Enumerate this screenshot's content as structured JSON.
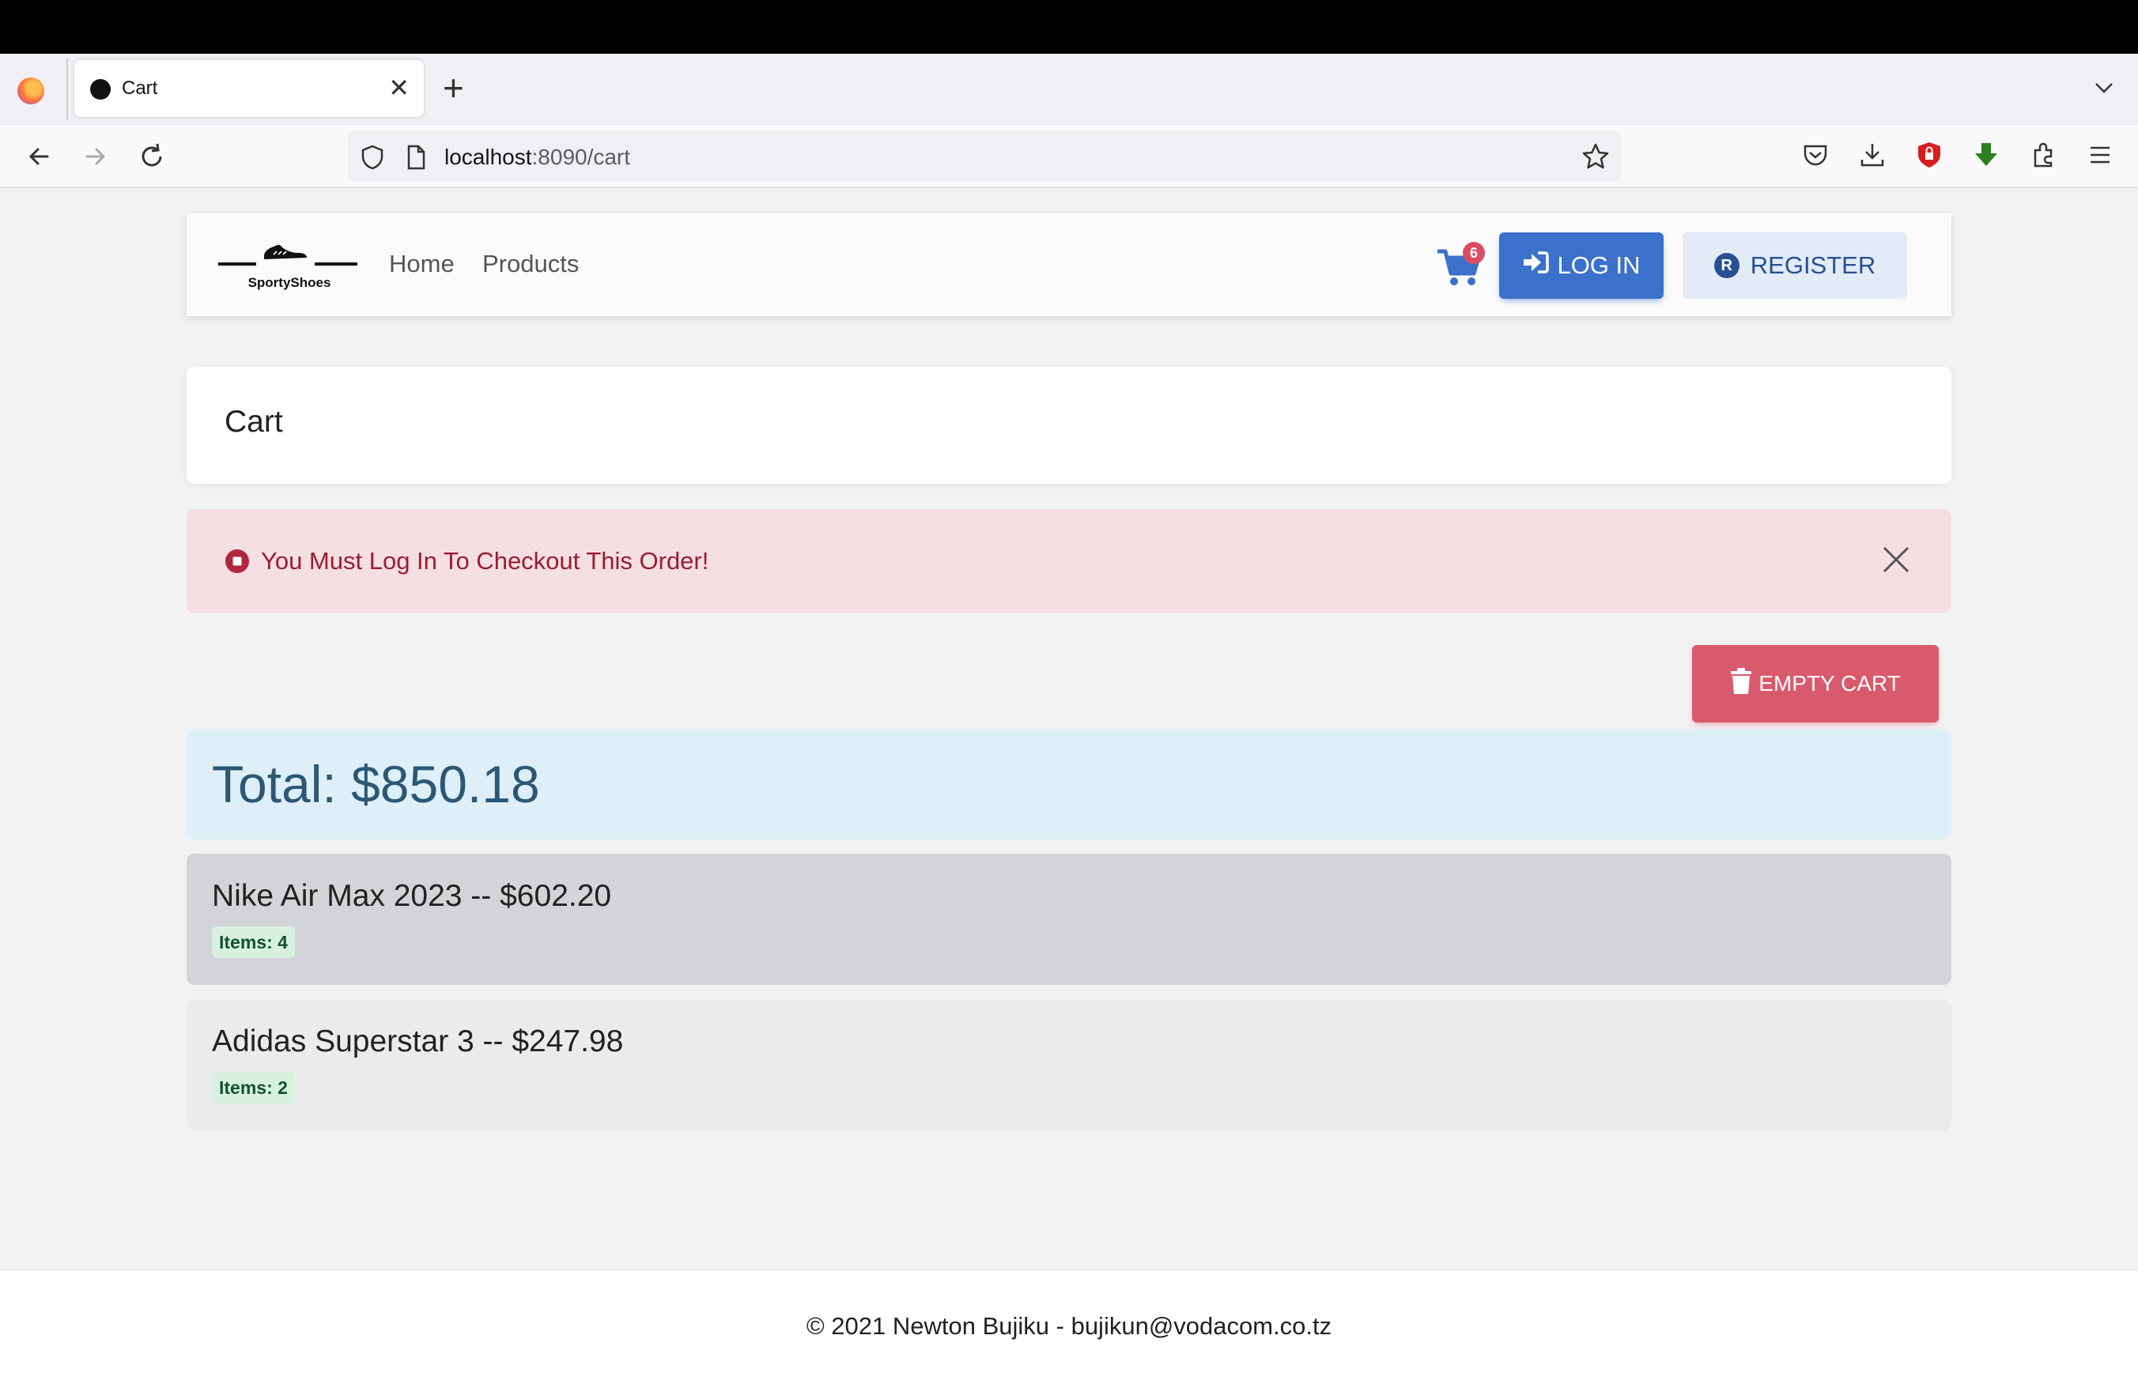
{
  "browser": {
    "tab_title": "Cart",
    "url_host": "localhost",
    "url_rest": ":8090/cart"
  },
  "site": {
    "brand": "SportyShoes",
    "nav": {
      "home": "Home",
      "products": "Products"
    },
    "cart_count": "6",
    "login_label": "LOG IN",
    "register_label": "REGISTER",
    "register_badge": "R"
  },
  "page": {
    "title": "Cart",
    "alert_message": "You Must Log In To Checkout This Order!",
    "empty_cart_label": "EMPTY CART",
    "total": "Total: $850.18",
    "items": [
      {
        "title": "Nike Air Max 2023 -- $602.20",
        "badge": "Items: 4"
      },
      {
        "title": "Adidas Superstar 3 -- $247.98",
        "badge": "Items: 2"
      }
    ]
  },
  "footer": {
    "text": "© 2021 Newton Bujiku - bujikun@vodacom.co.tz"
  },
  "colors": {
    "primary": "#3b71ca",
    "danger": "#dc4c64",
    "info_bg": "#dfeff7",
    "alert_bg": "#f5dfe3"
  }
}
